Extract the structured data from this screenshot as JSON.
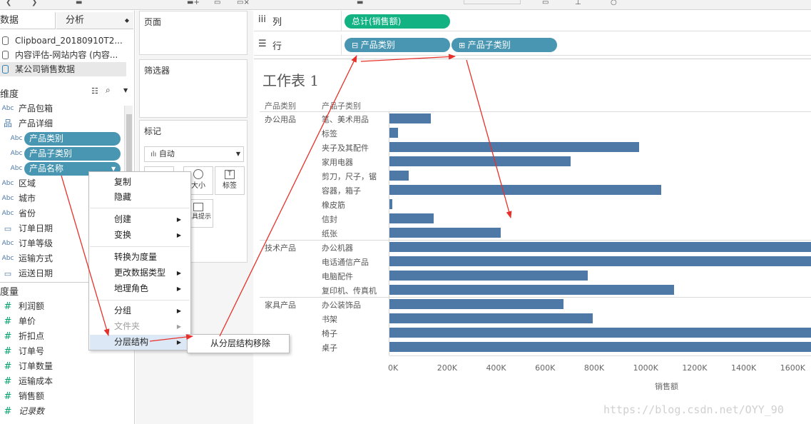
{
  "data_pane": {
    "tab_data": "数据",
    "tab_analysis": "分析",
    "datasources": [
      "Clipboard_20180910T2...",
      "内容评估-网站内容 (内容...",
      "某公司销售数据"
    ],
    "dimensions_title": "维度",
    "dimensions": [
      "产品包箱",
      "产品详细",
      "产品类别",
      "产品子类别",
      "产品名称",
      "区域",
      "城市",
      "省份",
      "订单日期",
      "订单等级",
      "运输方式",
      "运送日期"
    ],
    "measures_title": "度量",
    "measures": [
      "利润额",
      "单价",
      "折扣点",
      "订单号",
      "订单数量",
      "运输成本",
      "销售额",
      "记录数"
    ]
  },
  "shelves": {
    "pages": "页面",
    "filters": "筛选器",
    "marks": "标记",
    "marks_type": "自动",
    "mark_buttons": [
      "大小",
      "标签",
      "工具提示"
    ],
    "columns_label": "列",
    "rows_label": "行",
    "columns_pill": "总计(销售额)",
    "rows_pills": [
      "产品类别",
      "产品子类别"
    ]
  },
  "colors": {
    "pill_dim": "#4996b2",
    "pill_measure": "#12b283",
    "bar": "#4e79a7",
    "arrow": "#e8302a"
  },
  "worksheet": {
    "title": "工作表 1",
    "col_header_category": "产品类别",
    "col_header_subcategory": "产品子类别",
    "xlabel": "销售额",
    "watermark": "https://blog.csdn.net/OYY_90"
  },
  "context_menu": {
    "items": [
      "复制",
      "隐藏",
      "创建",
      "变换",
      "转换为度量",
      "更改数据类型",
      "地理角色",
      "分组",
      "文件夹",
      "分层结构"
    ],
    "submenu_item": "从分层结构移除"
  },
  "chart_data": {
    "type": "bar",
    "orientation": "horizontal",
    "groups": [
      {
        "category": "办公用品",
        "subcategories": [
          "笔、美术用品",
          "标签",
          "夹子及其配件",
          "家用电器",
          "剪刀，尺子，锯",
          "容器，箱子",
          "橡皮筋",
          "信封",
          "纸张"
        ],
        "values": [
          170000,
          35000,
          1020000,
          740000,
          80000,
          1110000,
          12000,
          180000,
          455000
        ]
      },
      {
        "category": "技术产品",
        "subcategories": [
          "办公机器",
          "电话通信产品",
          "电脑配件",
          "复印机、传真机"
        ],
        "values": [
          1750000,
          1750000,
          810000,
          1160000
        ]
      },
      {
        "category": "家具产品",
        "subcategories": [
          "办公装饰品",
          "书架",
          "椅子",
          "桌子"
        ],
        "values": [
          710000,
          830000,
          1750000,
          1750000
        ]
      }
    ],
    "xticks": [
      "0K",
      "200K",
      "400K",
      "600K",
      "800K",
      "1000K",
      "1200K",
      "1400K",
      "1600K"
    ],
    "xlim": [
      0,
      1720000
    ],
    "xlabel": "销售额",
    "ylabel": ""
  }
}
